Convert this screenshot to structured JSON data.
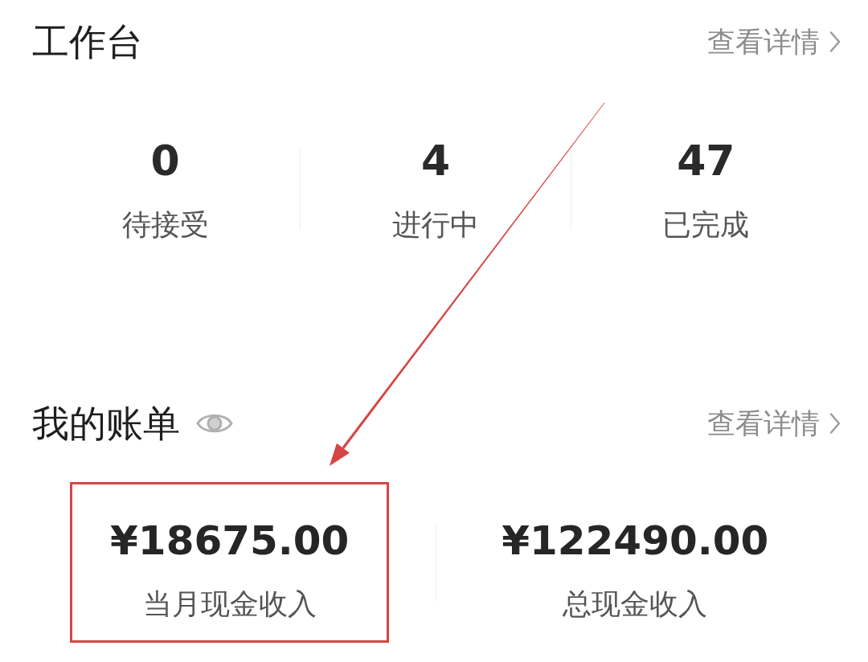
{
  "workbench": {
    "title": "工作台",
    "details_link": "查看详情",
    "stats": [
      {
        "value": "0",
        "label": "待接受"
      },
      {
        "value": "4",
        "label": "进行中"
      },
      {
        "value": "47",
        "label": "已完成"
      }
    ]
  },
  "bill": {
    "title": "我的账单",
    "amounts_visible": true,
    "details_link": "查看详情",
    "items": [
      {
        "amount": "¥18675.00",
        "label": "当月现金收入",
        "highlighted": true
      },
      {
        "amount": "¥122490.00",
        "label": "总现金收入",
        "highlighted": false
      }
    ]
  }
}
